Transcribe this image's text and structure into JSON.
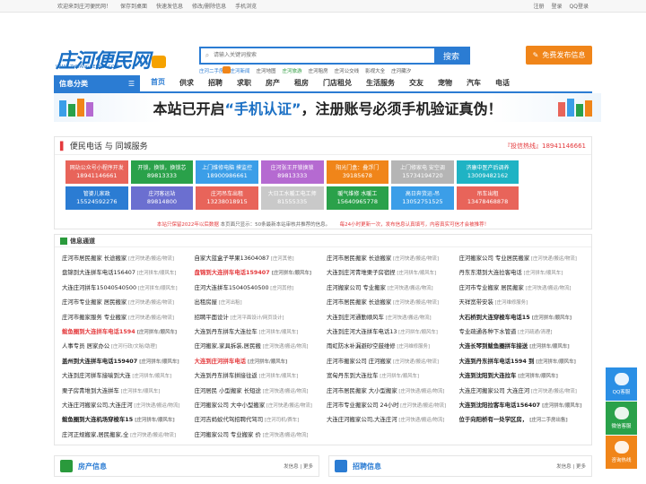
{
  "topbar": {
    "welcome": "欢迎来到庄河便民网！",
    "save_desktop": "保存到桌面",
    "quick_post": "快速发信息",
    "edit_delete": "修改/删除信息",
    "mobile": "手机浏览",
    "register": "注册",
    "login": "登录",
    "qq_login": "QQ登录"
  },
  "logo": {
    "text": "庄河便民网",
    "domain": "WWW.ZHUANGHEBMW.COM"
  },
  "search": {
    "placeholder": "请输入关键词搜索",
    "button": "搜索",
    "hot": [
      "庄河二手房",
      "庄河新闻",
      "庄河地图",
      "庄河旅游",
      "庄河租房",
      "庄河公交线",
      "影视大全",
      "庄河藏汐"
    ]
  },
  "publish_button": "免费发布信息",
  "nav": {
    "category": "信息分类",
    "items": [
      "首页",
      "供求",
      "招聘",
      "求职",
      "房产",
      "租房",
      "门店租兑",
      "生活服务",
      "交友",
      "宠物",
      "汽车",
      "电话"
    ]
  },
  "banner": {
    "before": "本站已开启",
    "highlight": "“手机认证”",
    "after": "，注册账号必须手机验证真伪！"
  },
  "phones": {
    "title": "便民电话 与 同城服务",
    "hotline_label": "『投信热线』",
    "hotline": "18941146661",
    "cells": [
      {
        "name": "网站公众号小程序开发",
        "num": "18941146661",
        "color": "#e8645a"
      },
      {
        "name": "开锁，换锁，换锁芯",
        "num": "89813333",
        "color": "#2aa14a"
      },
      {
        "name": "上门维修电脑 摸监控",
        "num": "18900986661",
        "color": "#3b9ee8"
      },
      {
        "name": "庄河张王开锁换锁",
        "num": "89813333",
        "color": "#b56ad1"
      },
      {
        "name": "阳光门盒：叠浮门",
        "num": "39185678",
        "color": "#f08519"
      },
      {
        "name": "上门修家电 安空调",
        "num": "15734194720",
        "color": "#b5b5b5"
      },
      {
        "name": "济康中医产后调养",
        "num": "13009482162",
        "color": "#1fb3c4"
      },
      {
        "name": "",
        "num": "",
        "color": "#ffffff"
      },
      {
        "name": "管婆儿家政",
        "num": "15524592276",
        "color": "#2b7cd3"
      },
      {
        "name": "庄河客运站",
        "num": "89814800",
        "color": "#6b6fd0"
      },
      {
        "name": "庄河吊车出租",
        "num": "13238018915",
        "color": "#e8645a"
      },
      {
        "name": "大日工水暖工电工师",
        "num": "81555335",
        "color": "#c9c9c9"
      },
      {
        "name": "暖气维修 水暖工",
        "num": "15640965778",
        "color": "#2aa14a"
      },
      {
        "name": "高日奔货运-吊",
        "num": "13052751525",
        "color": "#3b9ee8"
      },
      {
        "name": "吊车出租",
        "num": "13478468878",
        "color": "#e8645a"
      },
      {
        "name": "",
        "num": "",
        "color": "#ffffff"
      }
    ]
  },
  "notice": {
    "left": "本站只保留2022年以后数据",
    "mid": " 本页面只显示：50条最新本站审核并推荐的信息。",
    "right": "每24小时更新一次，发布信息认真填写，内容真实可信才会被推荐！"
  },
  "info": {
    "title": "信息通道",
    "rows": [
      [
        "庄河市居民搬家 长途搬家|庄河快递/搬运/物流",
        "自家大蓝盒子苹果13604087|庄河其他",
        "庄河市居民搬家 长途搬家|庄河快递/搬运/物流",
        "庄河搬家公司 专业居民搬家|庄河快递/搬运/物流"
      ],
      [
        "盘锦到大连拼车电话156407|庄河拼车/顺风车",
        "盘锦到大连拼车电话159407|庄河拼车/顺风车",
        "大连到庄河青堆栗子房宿捏|庄河拼车/顺风车",
        "丹东东港到大连拉客电话|庄河拼车/顺风车"
      ],
      [
        "大连庄河拼车15040540500|庄河拼车/顺风车",
        "庄河大连拼车15040540500|庄河其他",
        "庄河搬家公司 专业搬家|庄河快递/搬运/物流",
        "庄河市专业搬家 居民搬家|庄河快递/搬运/物流"
      ],
      [
        "庄河市专业搬家 居民搬家|庄河快递/搬运/物流",
        "出租房屋|庄河出租",
        "庄河市居民搬家 长途搬家|庄河快递/搬运/物流",
        "天祥宽带安装|庄河维修服务"
      ],
      [
        "庄河市搬家服务 专业搬家|庄河快递/搬运/物流",
        "招聘平面设计|庄河平面设计/网页设计",
        "大连到庄河通勤顺风车|庄河快递/搬运/物流",
        "大石桥到大连穿梭车电话15|庄河拼车/顺风车"
      ],
      [
        "鲅鱼圈到大连拼车电话1594|庄河拼车/顺风车",
        "大连到丹东拼车大连拉车|庄河拼车/顺风车",
        "大连到庄河大连拼车电话13|庄河拼车/顺风车",
        "专业疏通各种下水管道|庄河疏通/清理"
      ],
      [
        "人事专员 居家办公|庄河行政/文秘/助理",
        "庄河搬家,家具拆装,居民搬|庄河快递/搬运/物流",
        "雨虹防水补漏避砂空鼓维修|庄河维修服务",
        "大连长琴到鲅鱼圈拼车接送|庄河拼车/顺风车"
      ],
      [
        "盖州到大连拼车电话159407|庄河拼车/顺风车",
        "大连到庄河拼车电话|庄河拼车/顺风车",
        "庄河市搬家公司 庄河搬家|庄河快递/搬运/物流",
        "大连到丹东拼车电话1594 到|庄河拼车/顺风车"
      ],
      [
        "大连到庄河拼车接喻到大连|庄河拼车/顺风车",
        "大连到丹东拼车拼接往返|庄河拼车/顺风车",
        "宽甸丹东到大连拉车|庄河拼车/顺风车",
        "大连到沈阳到大连拉车|庄河拼车/顺风车"
      ],
      [
        "栗子房青堆到大连拼车|庄河拼车/顺风车",
        "庄河居民 小型搬家 长短途|庄河快递/搬运/物流",
        "庄河市居民搬家 大小型搬家|庄河快递/搬运/物流",
        "大连庄河搬家公司 大连庄河|庄河快递/搬运/物流"
      ],
      [
        "大连庄河搬家公司,大连庄河|庄河快递/搬运/物流",
        "庄河搬家公司 大中小型搬家|庄河快递/搬运/物流",
        "庄河市专业搬家公司 24小时|庄河快递/搬运/物流",
        "大连到沈阳拉客车电话156407|庄河拼车/顺风车"
      ],
      [
        "鲅鱼圈到大连机场穿梭车15|庄河拼车/顺风车",
        "庄河吉蚂蚁代驾招聘代驾司|庄河司机/赛车",
        "大连庄河搬家公司,大连庄河|庄河快递/搬运/物流",
        "位于向阳桥有一处学区房，|庄河二手房出售"
      ],
      [
        "庄河正规搬家,居民搬家,全|庄河快递/搬运/物流",
        "庄河搬家公司 专业搬家 价|庄河快递/搬运/物流",
        "",
        ""
      ]
    ]
  },
  "bottom": {
    "left_title": "房产信息",
    "right_title": "招聘信息",
    "more": "发信息 | 更多"
  },
  "side": [
    "QQ客服",
    "微信客服",
    "咨询热线"
  ]
}
